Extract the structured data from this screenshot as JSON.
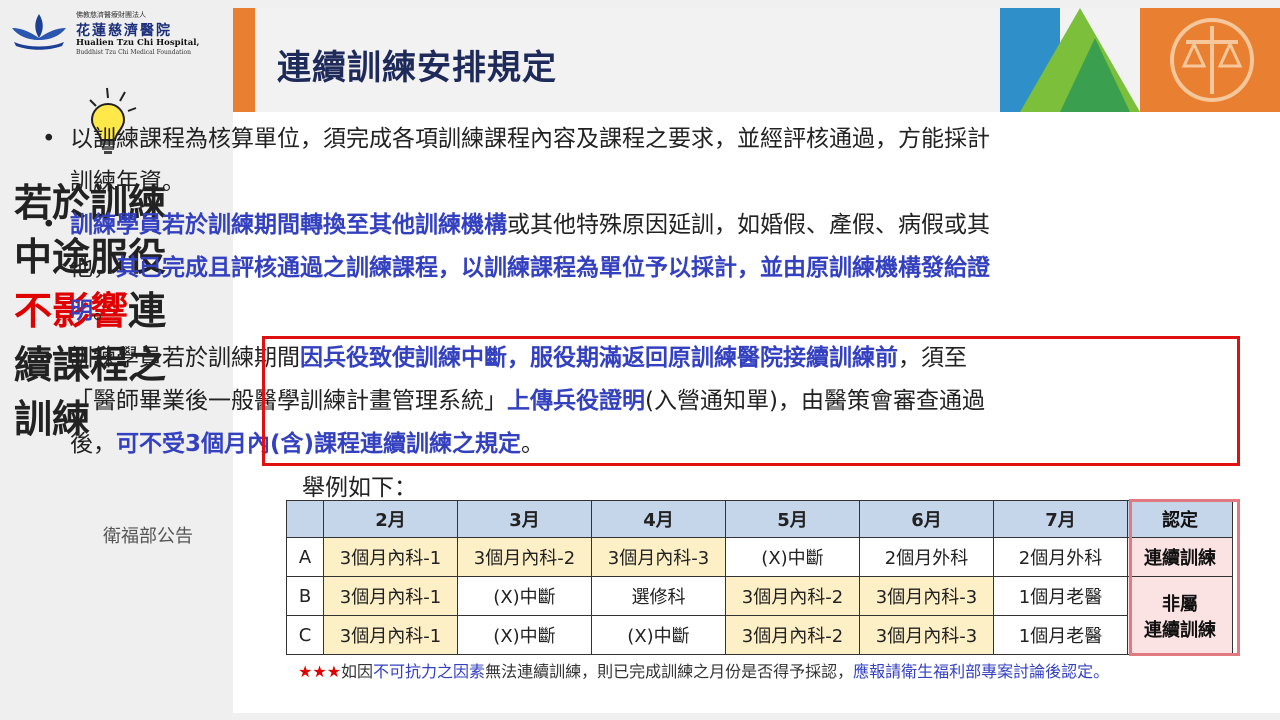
{
  "logo": {
    "small_text": "佛教慈濟醫療財團法人",
    "name_cn": "花蓮慈濟醫院",
    "name_en": "Hualien Tzu Chi Hospital,",
    "name_en2": "Buddhist Tzu Chi Medical Foundation"
  },
  "sidebar": {
    "line1": "若於訓練",
    "line2": "中途服役",
    "line3_red": "不影響",
    "line3_rest": "連",
    "line4": "續課程之",
    "line5": "訓練",
    "source": "衛福部公告"
  },
  "title": "連續訓練安排規定",
  "bullet": "•",
  "para1": "以訓練課程為核算單位，須完成各項訓練課程內容及課程之要求，並經評核通過，方能採計訓練年資。",
  "para2": {
    "a": "訓練學員若於訓練期間轉換至其他訓練機構",
    "b": "或其他特殊原因延訓，如婚假、產假、病假或其他，",
    "c": "其已完成且評核通過之訓練課程，以訓練課程為單位予以採計，並由原訓練機構發給證明",
    "d": "。"
  },
  "para3": {
    "a": "訓練學員若於訓練期間",
    "b": "因兵役致使訓練中斷，服役期滿返回原訓練醫院接續訓練前",
    "c": "，須至「醫師畢業後一般醫學訓練計畫管理系統」",
    "d": "上傳兵役證明",
    "e": "(入營通知單)，由醫策會審查通過後，",
    "f": "可不受3個月內(含)課程連續訓練之規定",
    "g": "。"
  },
  "example_label": "舉例如下：",
  "table": {
    "headers": [
      "",
      "2月",
      "3月",
      "4月",
      "5月",
      "6月",
      "7月",
      "認定"
    ],
    "rows": [
      {
        "label": "A",
        "cells": [
          "3個月內科-1",
          "3個月內科-2",
          "3個月內科-3",
          "(X)中斷",
          "2個月外科",
          "2個月外科"
        ]
      },
      {
        "label": "B",
        "cells": [
          "3個月內科-1",
          "(X)中斷",
          "選修科",
          "3個月內科-2",
          "3個月內科-3",
          "1個月老醫"
        ]
      },
      {
        "label": "C",
        "cells": [
          "3個月內科-1",
          "(X)中斷",
          "(X)中斷",
          "3個月內科-2",
          "3個月內科-3",
          "1個月老醫"
        ]
      }
    ],
    "result_a": "連續訓練",
    "result_bc_1": "非屬",
    "result_bc_2": "連續訓練"
  },
  "note": {
    "stars": "★★★",
    "a": "如因",
    "b": "不可抗力之因素",
    "c": "無法連續訓練，則已完成訓練之月份是否得予採認，",
    "d": "應報請衛生福利部專案討論後認定。"
  },
  "colors": {
    "accent_orange": "#e97f31",
    "title_navy": "#1e2a5a",
    "highlight_blue": "#3340c0",
    "alert_red": "#e01010",
    "table_header": "#c5d5ea",
    "cell_highlight": "#fdefc6",
    "result_pink": "#fbe2e3"
  }
}
